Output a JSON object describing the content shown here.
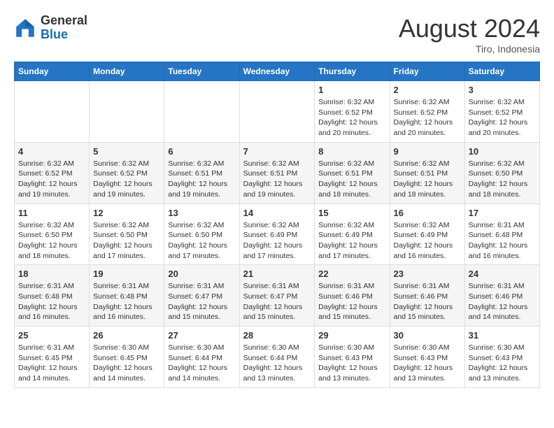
{
  "header": {
    "logo_general": "General",
    "logo_blue": "Blue",
    "month_title": "August 2024",
    "location": "Tiro, Indonesia"
  },
  "weekdays": [
    "Sunday",
    "Monday",
    "Tuesday",
    "Wednesday",
    "Thursday",
    "Friday",
    "Saturday"
  ],
  "weeks": [
    [
      {
        "day": "",
        "info": ""
      },
      {
        "day": "",
        "info": ""
      },
      {
        "day": "",
        "info": ""
      },
      {
        "day": "",
        "info": ""
      },
      {
        "day": "1",
        "info": "Sunrise: 6:32 AM\nSunset: 6:52 PM\nDaylight: 12 hours\nand 20 minutes."
      },
      {
        "day": "2",
        "info": "Sunrise: 6:32 AM\nSunset: 6:52 PM\nDaylight: 12 hours\nand 20 minutes."
      },
      {
        "day": "3",
        "info": "Sunrise: 6:32 AM\nSunset: 6:52 PM\nDaylight: 12 hours\nand 20 minutes."
      }
    ],
    [
      {
        "day": "4",
        "info": "Sunrise: 6:32 AM\nSunset: 6:52 PM\nDaylight: 12 hours\nand 19 minutes."
      },
      {
        "day": "5",
        "info": "Sunrise: 6:32 AM\nSunset: 6:52 PM\nDaylight: 12 hours\nand 19 minutes."
      },
      {
        "day": "6",
        "info": "Sunrise: 6:32 AM\nSunset: 6:51 PM\nDaylight: 12 hours\nand 19 minutes."
      },
      {
        "day": "7",
        "info": "Sunrise: 6:32 AM\nSunset: 6:51 PM\nDaylight: 12 hours\nand 19 minutes."
      },
      {
        "day": "8",
        "info": "Sunrise: 6:32 AM\nSunset: 6:51 PM\nDaylight: 12 hours\nand 18 minutes."
      },
      {
        "day": "9",
        "info": "Sunrise: 6:32 AM\nSunset: 6:51 PM\nDaylight: 12 hours\nand 18 minutes."
      },
      {
        "day": "10",
        "info": "Sunrise: 6:32 AM\nSunset: 6:50 PM\nDaylight: 12 hours\nand 18 minutes."
      }
    ],
    [
      {
        "day": "11",
        "info": "Sunrise: 6:32 AM\nSunset: 6:50 PM\nDaylight: 12 hours\nand 18 minutes."
      },
      {
        "day": "12",
        "info": "Sunrise: 6:32 AM\nSunset: 6:50 PM\nDaylight: 12 hours\nand 17 minutes."
      },
      {
        "day": "13",
        "info": "Sunrise: 6:32 AM\nSunset: 6:50 PM\nDaylight: 12 hours\nand 17 minutes."
      },
      {
        "day": "14",
        "info": "Sunrise: 6:32 AM\nSunset: 6:49 PM\nDaylight: 12 hours\nand 17 minutes."
      },
      {
        "day": "15",
        "info": "Sunrise: 6:32 AM\nSunset: 6:49 PM\nDaylight: 12 hours\nand 17 minutes."
      },
      {
        "day": "16",
        "info": "Sunrise: 6:32 AM\nSunset: 6:49 PM\nDaylight: 12 hours\nand 16 minutes."
      },
      {
        "day": "17",
        "info": "Sunrise: 6:31 AM\nSunset: 6:48 PM\nDaylight: 12 hours\nand 16 minutes."
      }
    ],
    [
      {
        "day": "18",
        "info": "Sunrise: 6:31 AM\nSunset: 6:48 PM\nDaylight: 12 hours\nand 16 minutes."
      },
      {
        "day": "19",
        "info": "Sunrise: 6:31 AM\nSunset: 6:48 PM\nDaylight: 12 hours\nand 16 minutes."
      },
      {
        "day": "20",
        "info": "Sunrise: 6:31 AM\nSunset: 6:47 PM\nDaylight: 12 hours\nand 15 minutes."
      },
      {
        "day": "21",
        "info": "Sunrise: 6:31 AM\nSunset: 6:47 PM\nDaylight: 12 hours\nand 15 minutes."
      },
      {
        "day": "22",
        "info": "Sunrise: 6:31 AM\nSunset: 6:46 PM\nDaylight: 12 hours\nand 15 minutes."
      },
      {
        "day": "23",
        "info": "Sunrise: 6:31 AM\nSunset: 6:46 PM\nDaylight: 12 hours\nand 15 minutes."
      },
      {
        "day": "24",
        "info": "Sunrise: 6:31 AM\nSunset: 6:46 PM\nDaylight: 12 hours\nand 14 minutes."
      }
    ],
    [
      {
        "day": "25",
        "info": "Sunrise: 6:31 AM\nSunset: 6:45 PM\nDaylight: 12 hours\nand 14 minutes."
      },
      {
        "day": "26",
        "info": "Sunrise: 6:30 AM\nSunset: 6:45 PM\nDaylight: 12 hours\nand 14 minutes."
      },
      {
        "day": "27",
        "info": "Sunrise: 6:30 AM\nSunset: 6:44 PM\nDaylight: 12 hours\nand 14 minutes."
      },
      {
        "day": "28",
        "info": "Sunrise: 6:30 AM\nSunset: 6:44 PM\nDaylight: 12 hours\nand 13 minutes."
      },
      {
        "day": "29",
        "info": "Sunrise: 6:30 AM\nSunset: 6:43 PM\nDaylight: 12 hours\nand 13 minutes."
      },
      {
        "day": "30",
        "info": "Sunrise: 6:30 AM\nSunset: 6:43 PM\nDaylight: 12 hours\nand 13 minutes."
      },
      {
        "day": "31",
        "info": "Sunrise: 6:30 AM\nSunset: 6:43 PM\nDaylight: 12 hours\nand 13 minutes."
      }
    ]
  ]
}
